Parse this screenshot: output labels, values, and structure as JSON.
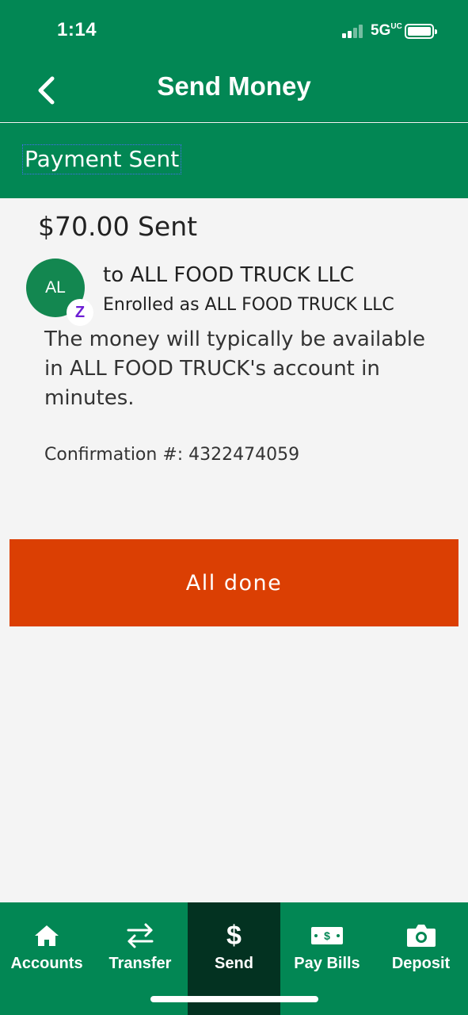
{
  "status_bar": {
    "time": "1:14",
    "network": "5G",
    "network_superscript": "UC"
  },
  "header": {
    "title": "Send Money",
    "back_icon": "chevron-left-icon"
  },
  "sub_header": {
    "title": "Payment Sent"
  },
  "payment": {
    "amount_text": "$70.00 Sent",
    "avatar_initials": "AL",
    "zelle_badge": "Z",
    "recipient_line": "to ALL FOOD TRUCK LLC",
    "enrolled_line": "Enrolled as ALL FOOD TRUCK LLC",
    "message": "The money will typically be available in ALL FOOD TRUCK's account in minutes.",
    "confirmation": "Confirmation #: 4322474059"
  },
  "done_button": {
    "label": "All done"
  },
  "tab_bar": {
    "items": [
      {
        "label": "Accounts",
        "icon": "home-icon",
        "active": false
      },
      {
        "label": "Transfer",
        "icon": "transfer-arrows-icon",
        "active": false
      },
      {
        "label": "Send",
        "icon": "dollar-icon",
        "active": true
      },
      {
        "label": "Pay Bills",
        "icon": "bill-icon",
        "active": false
      },
      {
        "label": "Deposit",
        "icon": "camera-icon",
        "active": false
      }
    ]
  },
  "colors": {
    "brand_green": "#028754",
    "active_tab": "#033221",
    "action_orange": "#db3f03",
    "zelle_purple": "#6d1ed4"
  }
}
